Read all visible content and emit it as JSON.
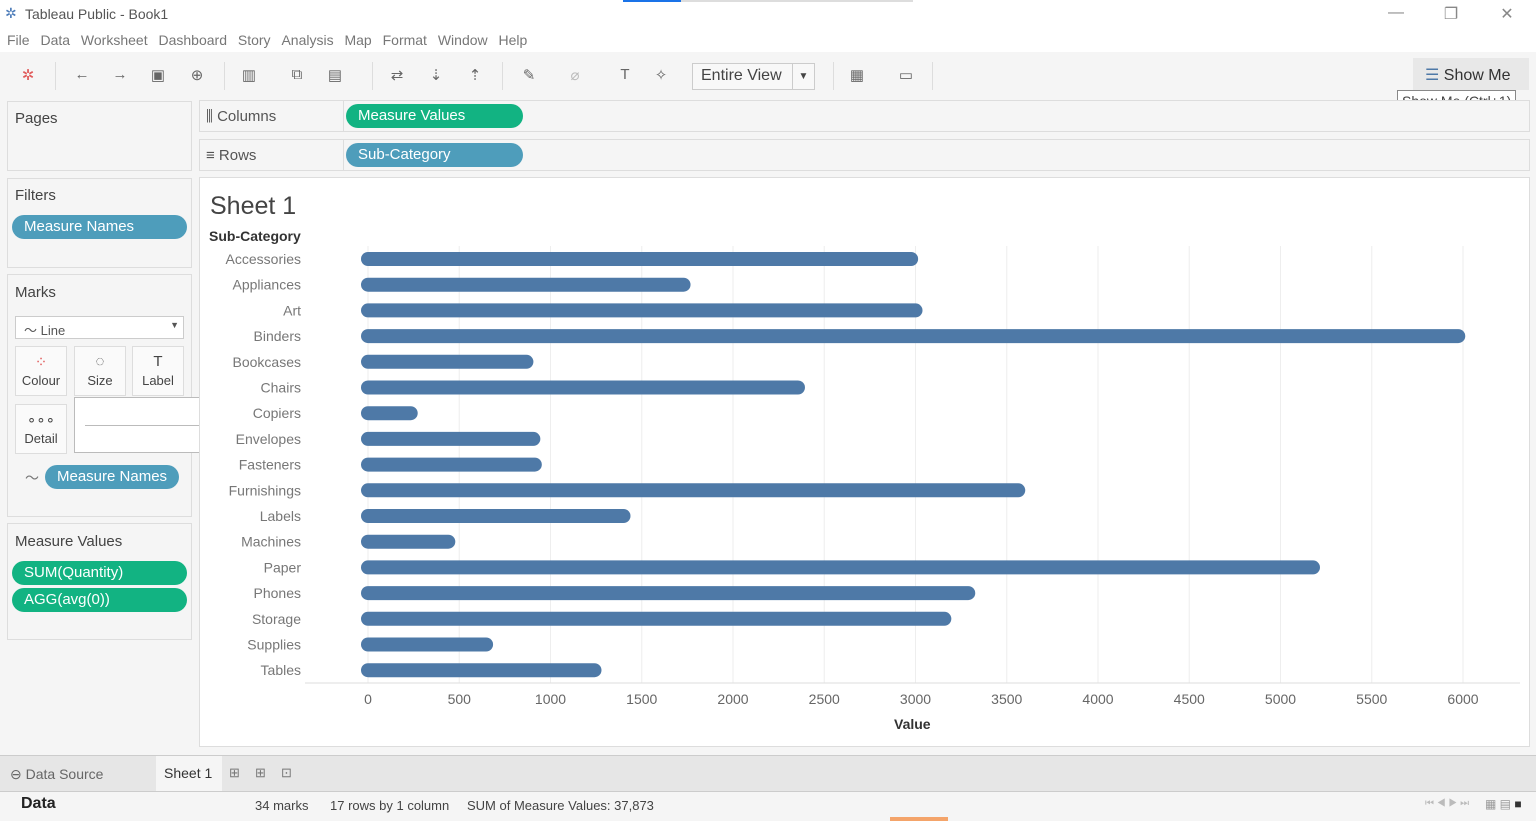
{
  "window": {
    "title": "Tableau Public - Book1",
    "minimize": "—",
    "restore": "❐",
    "close": "✕"
  },
  "menu": [
    "File",
    "Data",
    "Worksheet",
    "Dashboard",
    "Story",
    "Analysis",
    "Map",
    "Format",
    "Window",
    "Help"
  ],
  "toolbar": {
    "fit": "Entire View",
    "show_me": "Show Me",
    "show_me_tooltip": "Show Me (Ctrl+1)"
  },
  "pages": {
    "title": "Pages"
  },
  "filters": {
    "title": "Filters",
    "pills": [
      "Measure Names"
    ]
  },
  "marks": {
    "title": "Marks",
    "type": "Line",
    "buttons": [
      "Colour",
      "Size",
      "Label",
      "Detail"
    ],
    "pill": "Measure Names",
    "size_slider": 0.85
  },
  "measure_values": {
    "title": "Measure Values",
    "pills": [
      "SUM(Quantity)",
      "AGG(avg(0))"
    ]
  },
  "shelves": {
    "columns_label": "Columns",
    "columns_pill": "Measure Values",
    "rows_label": "Rows",
    "rows_pill": "Sub-Category"
  },
  "sheet": {
    "title": "Sheet 1"
  },
  "chart_data": {
    "type": "bar",
    "row_header": "Sub-Category",
    "xlabel": "Value",
    "categories": [
      "Accessories",
      "Appliances",
      "Art",
      "Binders",
      "Bookcases",
      "Chairs",
      "Copiers",
      "Envelopes",
      "Fasteners",
      "Furnishings",
      "Labels",
      "Machines",
      "Paper",
      "Phones",
      "Storage",
      "Supplies",
      "Tables"
    ],
    "values": [
      2976,
      1729,
      3000,
      5974,
      868,
      2356,
      234,
      906,
      914,
      3563,
      1400,
      440,
      5178,
      3289,
      3158,
      647,
      1241
    ],
    "xlim": [
      0,
      6000
    ],
    "xticks": [
      0,
      500,
      1000,
      1500,
      2000,
      2500,
      3000,
      3500,
      4000,
      4500,
      5000,
      5500,
      6000
    ],
    "grid": true,
    "color": "#4e79a7"
  },
  "tabs": {
    "data_source": "Data Source",
    "sheet": "Sheet 1"
  },
  "status": {
    "data": "Data",
    "marks": "34 marks",
    "rows": "17 rows by 1 column",
    "sum": "SUM of Measure Values: 37,873"
  }
}
